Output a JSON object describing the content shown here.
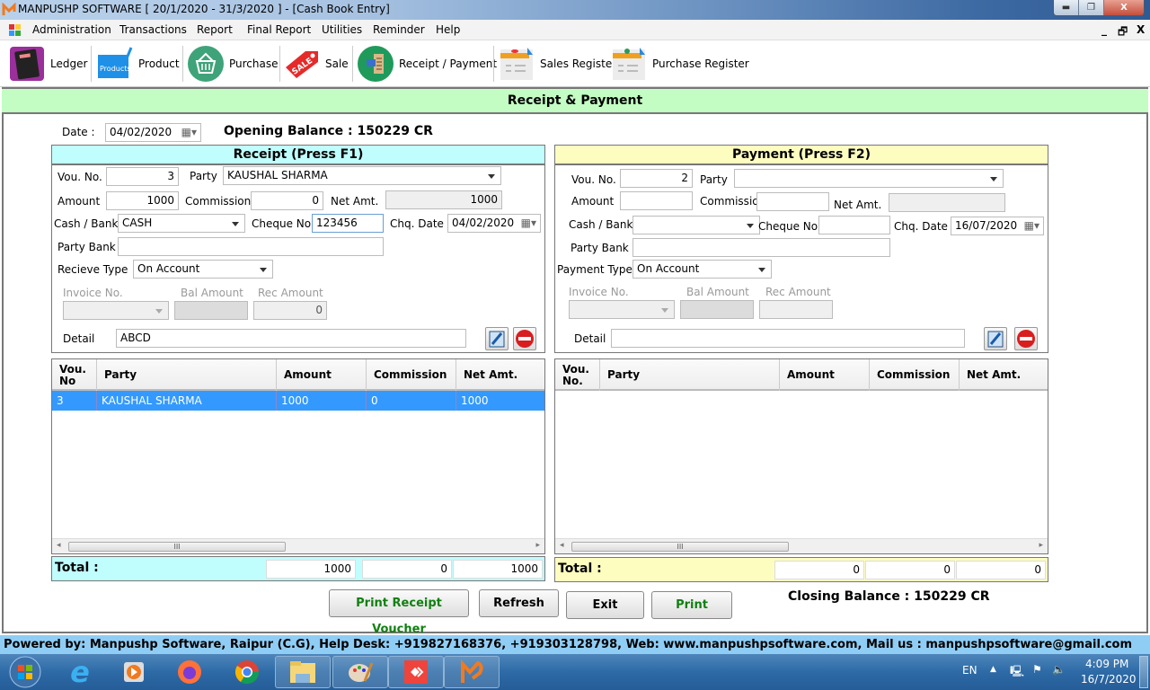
{
  "window": {
    "title": "MANPUSHP SOFTWARE [ 20/1/2020 - 31/3/2020 ]   - [Cash Book Entry]",
    "controls": [
      "minimize",
      "restore",
      "close"
    ]
  },
  "menubar": {
    "items": [
      "Administration",
      "Transactions",
      "Report",
      "Final Report",
      "Utilities",
      "Reminder",
      "Help"
    ],
    "mdi_controls": [
      "_",
      "🗗",
      "X"
    ]
  },
  "toolbar": {
    "items": [
      {
        "label": "Ledger",
        "icon": "ledger-book-icon"
      },
      {
        "label": "Product",
        "icon": "products-icon"
      },
      {
        "label": "Purchase",
        "icon": "basket-icon"
      },
      {
        "label": "Sale",
        "icon": "sale-tag-icon"
      },
      {
        "label": "Receipt / Payment",
        "icon": "receipt-payment-icon"
      },
      {
        "label": "Sales Register",
        "icon": "register-icon"
      },
      {
        "label": "Purchase Register",
        "icon": "register-icon"
      }
    ]
  },
  "form": {
    "header": "Receipt & Payment",
    "date_label": "Date :",
    "date_value": "04/02/2020",
    "opening_balance": "Opening Balance : 150229 CR",
    "closing_balance": "Closing Balance : 150229 CR",
    "colors": {
      "header_bg": "#c3fdc3",
      "receipt_bg": "#c0fdfd",
      "payment_bg": "#fdfdc0",
      "selected_row": "#3399ff"
    }
  },
  "receipt": {
    "title": "Receipt (Press F1)",
    "labels": {
      "vou_no": "Vou. No.",
      "party": "Party",
      "amount": "Amount",
      "commission": "Commission",
      "net_amt": "Net Amt.",
      "cash_bank": "Cash / Bank",
      "cheque_no": "Cheque No",
      "chq_date": "Chq.  Date",
      "party_bank": "Party Bank",
      "type": "Recieve Type",
      "invoice_no": "Invoice No.",
      "bal_amount": "Bal Amount",
      "rec_amount": "Rec Amount",
      "detail": "Detail"
    },
    "values": {
      "vou_no": "3",
      "party": "KAUSHAL SHARMA",
      "amount": "1000",
      "commission": "0",
      "net_amt": "1000",
      "cash_bank": "CASH",
      "cheque_no": "123456",
      "chq_date": "04/02/2020",
      "party_bank": "",
      "type": "On Account",
      "invoice_no": "",
      "bal_amount": "",
      "rec_amount": "0",
      "detail": "ABCD"
    },
    "grid": {
      "columns": [
        "Vou.\nNo",
        "Party",
        "Amount",
        "Commission",
        "Net Amt."
      ],
      "rows": [
        [
          "3",
          "KAUSHAL SHARMA",
          "1000",
          "0",
          "1000"
        ]
      ]
    },
    "total": {
      "label": "Total :",
      "amount": "1000",
      "commission": "0",
      "net_amt": "1000"
    }
  },
  "payment": {
    "title": "Payment (Press F2)",
    "labels": {
      "vou_no": "Vou. No.",
      "party": "Party",
      "amount": "Amount",
      "commission": "Commission",
      "net_amt": "Net Amt.",
      "cash_bank": "Cash / Bank",
      "cheque_no": "Cheque No",
      "chq_date": "Chq.  Date",
      "party_bank": "Party Bank",
      "type": "Payment Type",
      "invoice_no": "Invoice No.",
      "bal_amount": "Bal Amount",
      "rec_amount": "Rec Amount",
      "detail": "Detail"
    },
    "values": {
      "vou_no": "2",
      "party": "",
      "amount": "",
      "commission": "",
      "net_amt": "",
      "cash_bank": "",
      "cheque_no": "",
      "chq_date": "16/07/2020",
      "party_bank": "",
      "type": "On Account",
      "invoice_no": "",
      "bal_amount": "",
      "rec_amount": "",
      "detail": ""
    },
    "grid": {
      "columns": [
        "Vou.\nNo.",
        "Party",
        "Amount",
        "Commission",
        "Net Amt."
      ],
      "rows": []
    },
    "total": {
      "label": "Total :",
      "amount": "0",
      "commission": "0",
      "net_amt": "0"
    }
  },
  "buttons": {
    "print_receipt": "Print Receipt Voucher",
    "refresh": "Refresh",
    "exit": "Exit",
    "print": "Print"
  },
  "footer": "Powered by: Manpushp Software, Raipur (C.G), Help Desk: +919827168376, +919303128798, Web: www.manpushpsoftware.com,  Mail us :  manpushpsoftware@gmail.com",
  "taskbar": {
    "apps": [
      "start",
      "internet-explorer",
      "media-player",
      "firefox",
      "chrome",
      "file-explorer",
      "paint",
      "anydesk",
      "manpushp"
    ],
    "lang": "EN",
    "time": "4:09 PM",
    "date": "16/7/2020"
  }
}
